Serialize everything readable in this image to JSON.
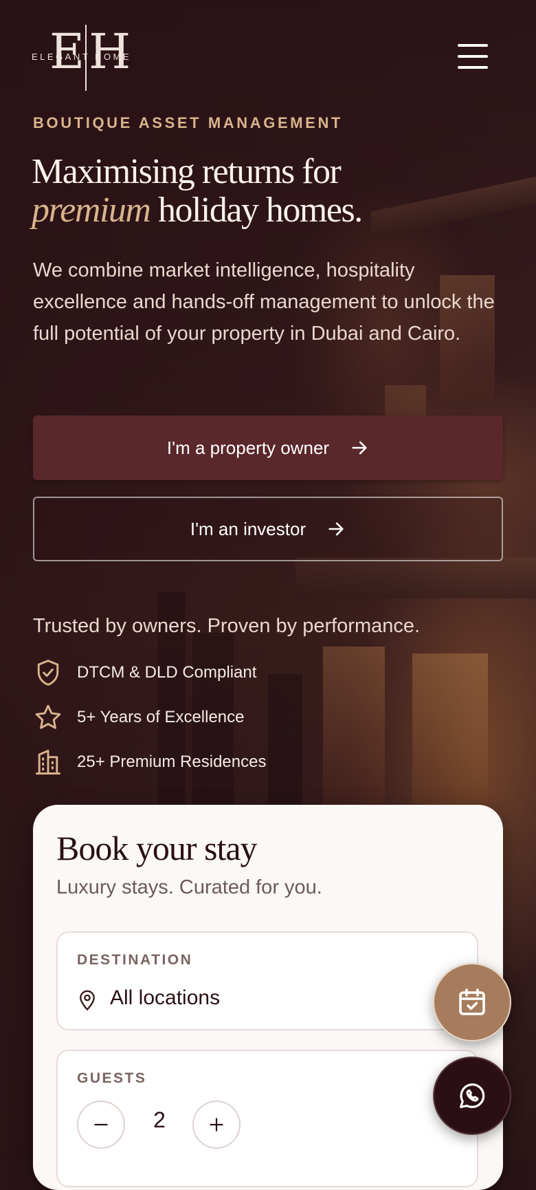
{
  "brand": {
    "monogram": "EH",
    "wordmark": "ELEGANT HOME"
  },
  "hero": {
    "eyebrow": "BOUTIQUE ASSET MANAGEMENT",
    "headline_line1": "Maximising returns for",
    "headline_emphasis": "premium",
    "headline_rest": " holiday homes.",
    "lead": "We combine market intelligence, hospitality excellence and hands-off management to unlock the full potential of your property in Dubai and Cairo.",
    "cta_owner": "I'm a property owner",
    "cta_investor": "I'm an investor"
  },
  "trust": {
    "heading": "Trusted by owners. Proven by performance.",
    "items": [
      {
        "icon": "shield-check-icon",
        "label": "DTCM & DLD Compliant"
      },
      {
        "icon": "star-icon",
        "label": "5+ Years of Excellence"
      },
      {
        "icon": "building-icon",
        "label": "25+ Premium Residences"
      }
    ]
  },
  "booking": {
    "title": "Book your stay",
    "subtitle": "Luxury stays. Curated for you.",
    "destination_label": "DESTINATION",
    "destination_value": "All locations",
    "guests_label": "GUESTS",
    "guests_value": "2"
  },
  "colors": {
    "accent": "#d9b48b",
    "primary_button": "#5a272b",
    "fab_calendar": "#a67c5c",
    "fab_whatsapp": "#2b0f14"
  }
}
